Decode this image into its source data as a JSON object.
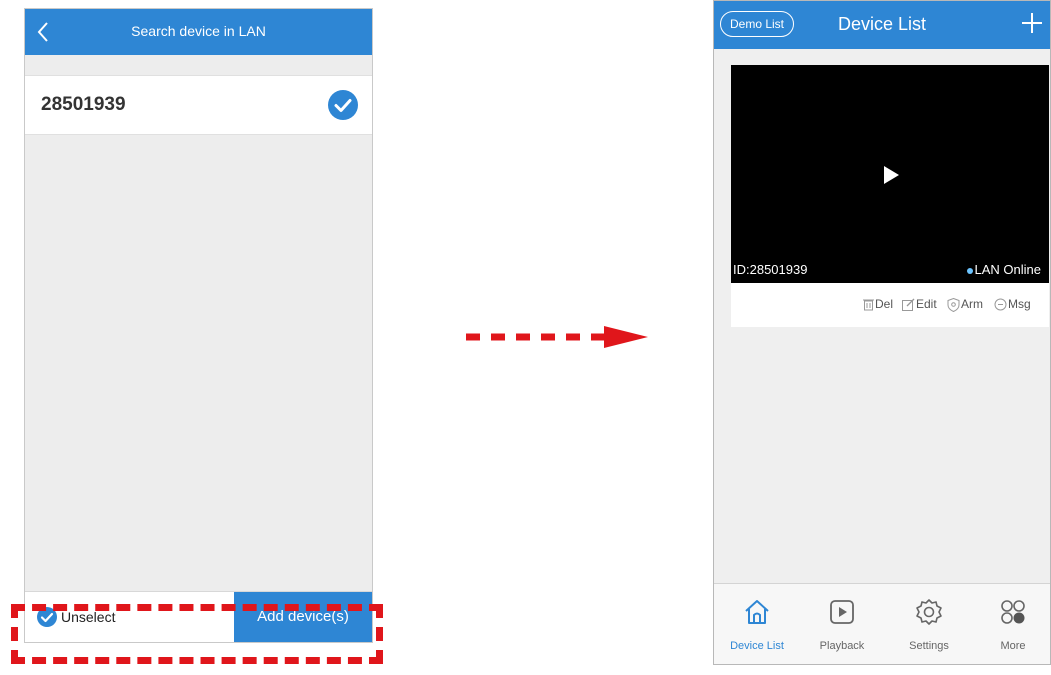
{
  "left_screen": {
    "title": "Search device in LAN",
    "device_id": "28501939",
    "unselect_label": "Unselect",
    "add_button_label": "Add device(s)"
  },
  "right_screen": {
    "demo_button_label": "Demo List",
    "title": "Device List",
    "video": {
      "device_id": "ID:28501939",
      "status": "LAN Online"
    },
    "actions": [
      {
        "label": "Del",
        "icon": "trash-icon"
      },
      {
        "label": "Edit",
        "icon": "edit-icon"
      },
      {
        "label": "Arm",
        "icon": "shield-icon"
      },
      {
        "label": "Msg",
        "icon": "message-icon"
      }
    ],
    "tabs": [
      {
        "label": "Device List",
        "icon": "home-icon",
        "active": true
      },
      {
        "label": "Playback",
        "icon": "play-box-icon",
        "active": false
      },
      {
        "label": "Settings",
        "icon": "gear-icon",
        "active": false
      },
      {
        "label": "More",
        "icon": "grid-dots-icon",
        "active": false
      }
    ]
  },
  "colors": {
    "accent": "#2e86d4",
    "highlight": "#e0161b"
  }
}
